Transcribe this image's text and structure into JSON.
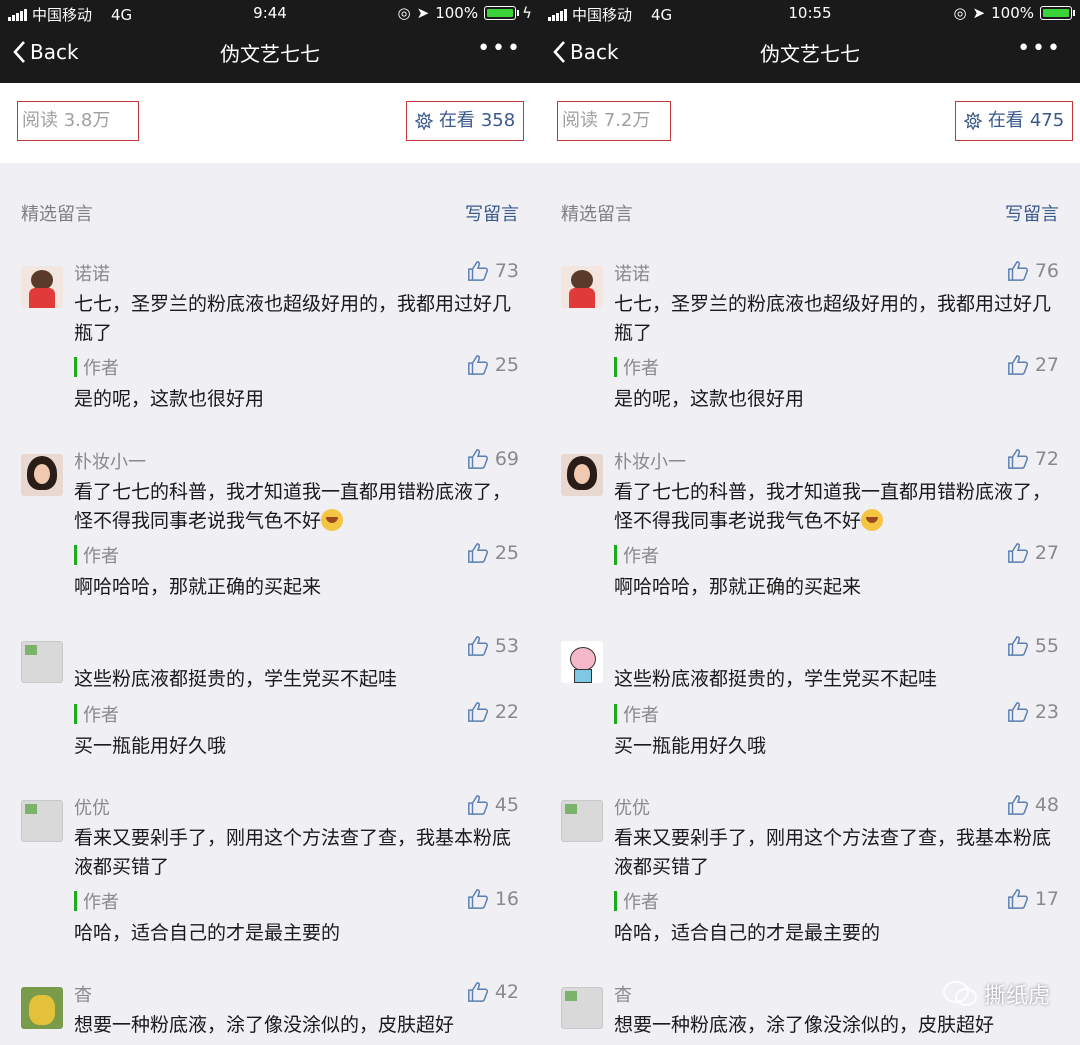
{
  "panels": [
    {
      "status": {
        "carrier": "中国移动",
        "network": "4G",
        "time": "9:44",
        "battery": "100%"
      },
      "nav": {
        "back": "Back",
        "title": "伪文艺七七",
        "more": "•••"
      },
      "stats": {
        "read": "阅读 3.8万",
        "watch_label": "在看",
        "watch_count": "358"
      },
      "section": {
        "title": "精选留言",
        "write": "写留言"
      },
      "comments": [
        {
          "name": "诺诺",
          "likes": "73",
          "text": "七七，圣罗兰的粉底液也超级好用的，我都用过好几瓶了",
          "author_label": "作者",
          "author_likes": "25",
          "reply": "是的呢，这款也很好用"
        },
        {
          "name": "朴妆小一",
          "likes": "69",
          "text": "看了七七的科普，我才知道我一直都用错粉底液了，怪不得我同事老说我气色不好",
          "author_label": "作者",
          "author_likes": "25",
          "reply": "啊哈哈哈，那就正确的买起来"
        },
        {
          "name": "",
          "likes": "53",
          "text": "这些粉底液都挺贵的，学生党买不起哇",
          "author_label": "作者",
          "author_likes": "22",
          "reply": "买一瓶能用好久哦"
        },
        {
          "name": "优优",
          "likes": "45",
          "text": "看来又要剁手了，刚用这个方法查了查，我基本粉底液都买错了",
          "author_label": "作者",
          "author_likes": "16",
          "reply": "哈哈，适合自己的才是最主要的"
        },
        {
          "name": "杳",
          "likes": "42",
          "text": "想要一种粉底液，涂了像没涂似的，皮肤超好"
        }
      ]
    },
    {
      "status": {
        "carrier": "中国移动",
        "network": "4G",
        "time": "10:55",
        "battery": "100%"
      },
      "nav": {
        "back": "Back",
        "title": "伪文艺七七",
        "more": "•••"
      },
      "stats": {
        "read": "阅读 7.2万",
        "watch_label": "在看",
        "watch_count": "475"
      },
      "section": {
        "title": "精选留言",
        "write": "写留言"
      },
      "comments": [
        {
          "name": "诺诺",
          "likes": "76",
          "text": "七七，圣罗兰的粉底液也超级好用的，我都用过好几瓶了",
          "author_label": "作者",
          "author_likes": "27",
          "reply": "是的呢，这款也很好用"
        },
        {
          "name": "朴妆小一",
          "likes": "72",
          "text": "看了七七的科普，我才知道我一直都用错粉底液了，怪不得我同事老说我气色不好",
          "author_label": "作者",
          "author_likes": "27",
          "reply": "啊哈哈哈，那就正确的买起来"
        },
        {
          "name": "",
          "likes": "55",
          "text": "这些粉底液都挺贵的，学生党买不起哇",
          "author_label": "作者",
          "author_likes": "23",
          "reply": "买一瓶能用好久哦"
        },
        {
          "name": "优优",
          "likes": "48",
          "text": "看来又要剁手了，刚用这个方法查了查，我基本粉底液都买错了",
          "author_label": "作者",
          "author_likes": "17",
          "reply": "哈哈，适合自己的才是最主要的"
        },
        {
          "name": "杳",
          "likes": "",
          "text": "想要一种粉底液，涂了像没涂似的，皮肤超好"
        }
      ]
    }
  ],
  "watermark": "撕纸虎",
  "colors": {
    "nav_bg": "#1a1a1a",
    "link": "#3a5a8c",
    "highlight_box": "#c2373b",
    "author_bar": "#1aad19"
  },
  "icons": {
    "back": "chevron-left-icon",
    "more": "more-dots-icon",
    "watch": "flower-icon",
    "like": "thumbs-up-icon"
  }
}
